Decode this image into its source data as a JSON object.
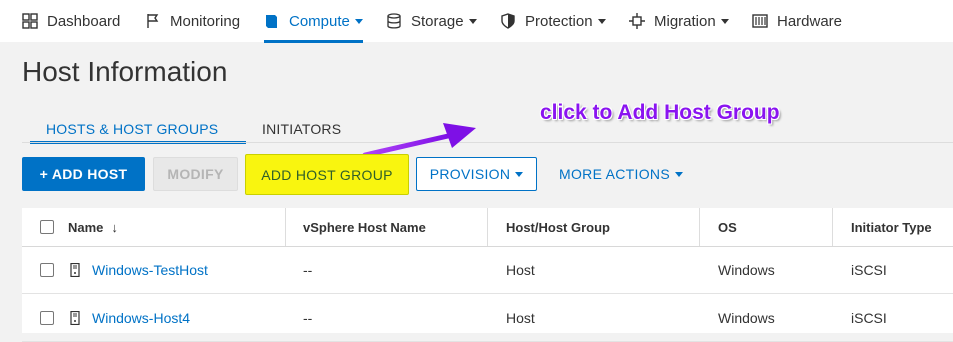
{
  "nav": {
    "items": [
      {
        "label": "Dashboard",
        "icon": "grid-icon"
      },
      {
        "label": "Monitoring",
        "icon": "flag-icon"
      },
      {
        "label": "Compute",
        "icon": "book-icon",
        "active": true,
        "dropdown": true
      },
      {
        "label": "Storage",
        "icon": "database-icon",
        "dropdown": true
      },
      {
        "label": "Protection",
        "icon": "shield-icon",
        "dropdown": true
      },
      {
        "label": "Migration",
        "icon": "migration-icon",
        "dropdown": true
      },
      {
        "label": "Hardware",
        "icon": "server-icon"
      }
    ]
  },
  "page": {
    "title": "Host Information"
  },
  "tabs": [
    {
      "label": "HOSTS & HOST GROUPS",
      "active": true
    },
    {
      "label": "INITIATORS",
      "active": false
    }
  ],
  "toolbar": {
    "add_host": "+ ADD HOST",
    "modify": "MODIFY",
    "add_host_group": "ADD HOST GROUP",
    "provision": "PROVISION",
    "more_actions": "MORE ACTIONS"
  },
  "annotation": {
    "text": "click to Add Host Group",
    "color": "#8a14f0"
  },
  "table": {
    "columns": [
      "Name",
      "vSphere Host Name",
      "Host/Host Group",
      "OS",
      "Initiator Type"
    ],
    "sort_indicator": "↓",
    "rows": [
      {
        "name": "Windows-TestHost",
        "vsphere": "--",
        "type": "Host",
        "os": "Windows",
        "initiator": "iSCSI"
      },
      {
        "name": "Windows-Host4",
        "vsphere": "--",
        "type": "Host",
        "os": "Windows",
        "initiator": "iSCSI"
      }
    ]
  },
  "colors": {
    "accent": "#0072c6",
    "highlight": "#f9f50f",
    "annotation": "#8a14f0"
  }
}
